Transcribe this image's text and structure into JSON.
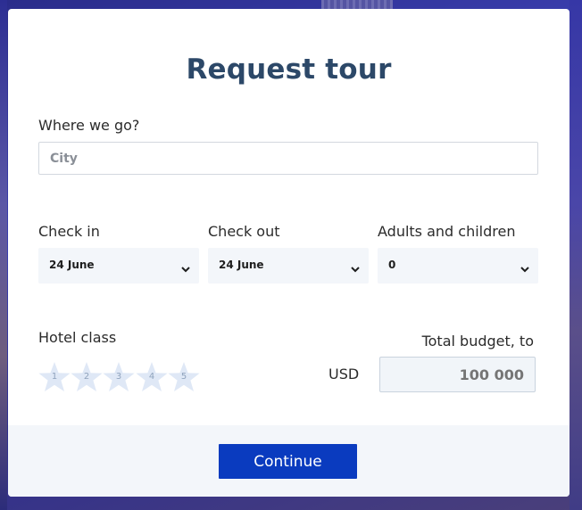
{
  "form": {
    "title": "Request tour",
    "destination": {
      "label": "Where we go?",
      "placeholder": "City",
      "value": ""
    },
    "check_in": {
      "label": "Check in",
      "selected": "24 June"
    },
    "check_out": {
      "label": "Check out",
      "selected": "24 June"
    },
    "guests": {
      "label": "Adults and children",
      "selected": "0"
    },
    "hotel_class": {
      "label": "Hotel class",
      "stars": [
        "1",
        "2",
        "3",
        "4",
        "5"
      ],
      "selected": 0
    },
    "budget": {
      "label": "Total budget, to",
      "currency": "USD",
      "placeholder": "100 000"
    },
    "continue_label": "Continue"
  },
  "colors": {
    "title": "#2c4868",
    "primary_button": "#0a3bbf",
    "field_bg": "#f3f6fa",
    "star_fill": "#dfe8f6"
  },
  "icons": {
    "select_arrow": "chevron-down-icon",
    "rating": "star-icon"
  }
}
